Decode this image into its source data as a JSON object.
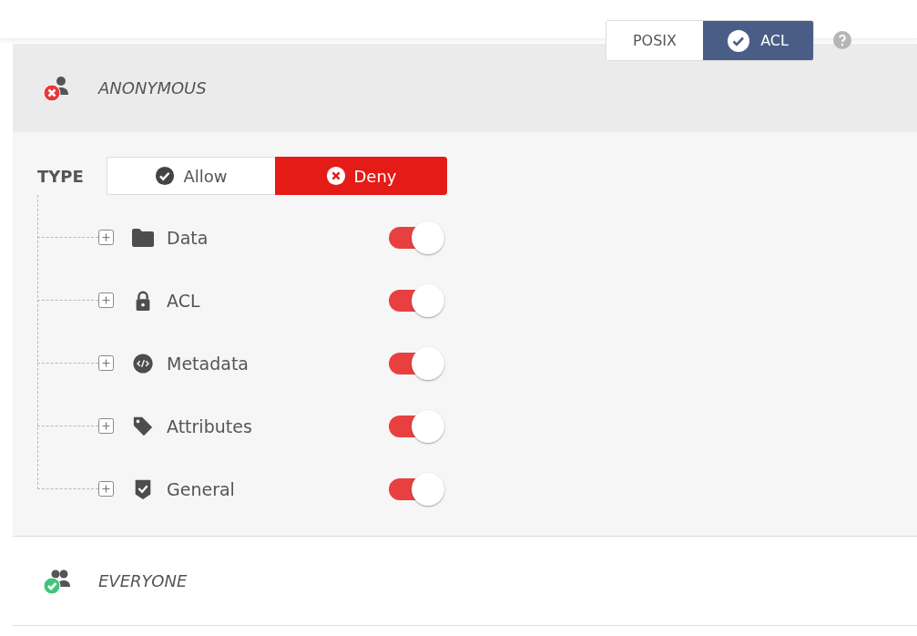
{
  "mode_toggle": [
    {
      "label": "POSIX",
      "selected": false
    },
    {
      "label": "ACL",
      "selected": true
    }
  ],
  "principals": [
    {
      "name": "ANONYMOUS",
      "allowed": false,
      "expanded": true,
      "type_label": "TYPE",
      "type_options": [
        {
          "label": "Allow",
          "kind": "allow",
          "selected": false
        },
        {
          "label": "Deny",
          "kind": "deny",
          "selected": true
        }
      ],
      "permissions": [
        {
          "label": "Data",
          "kind": "folder",
          "on": true
        },
        {
          "label": "ACL",
          "kind": "lock",
          "on": true
        },
        {
          "label": "Metadata",
          "kind": "code",
          "on": true
        },
        {
          "label": "Attributes",
          "kind": "tag",
          "on": true
        },
        {
          "label": "General",
          "kind": "shield",
          "on": true
        }
      ]
    },
    {
      "name": "EVERYONE",
      "allowed": true,
      "expanded": false
    }
  ]
}
